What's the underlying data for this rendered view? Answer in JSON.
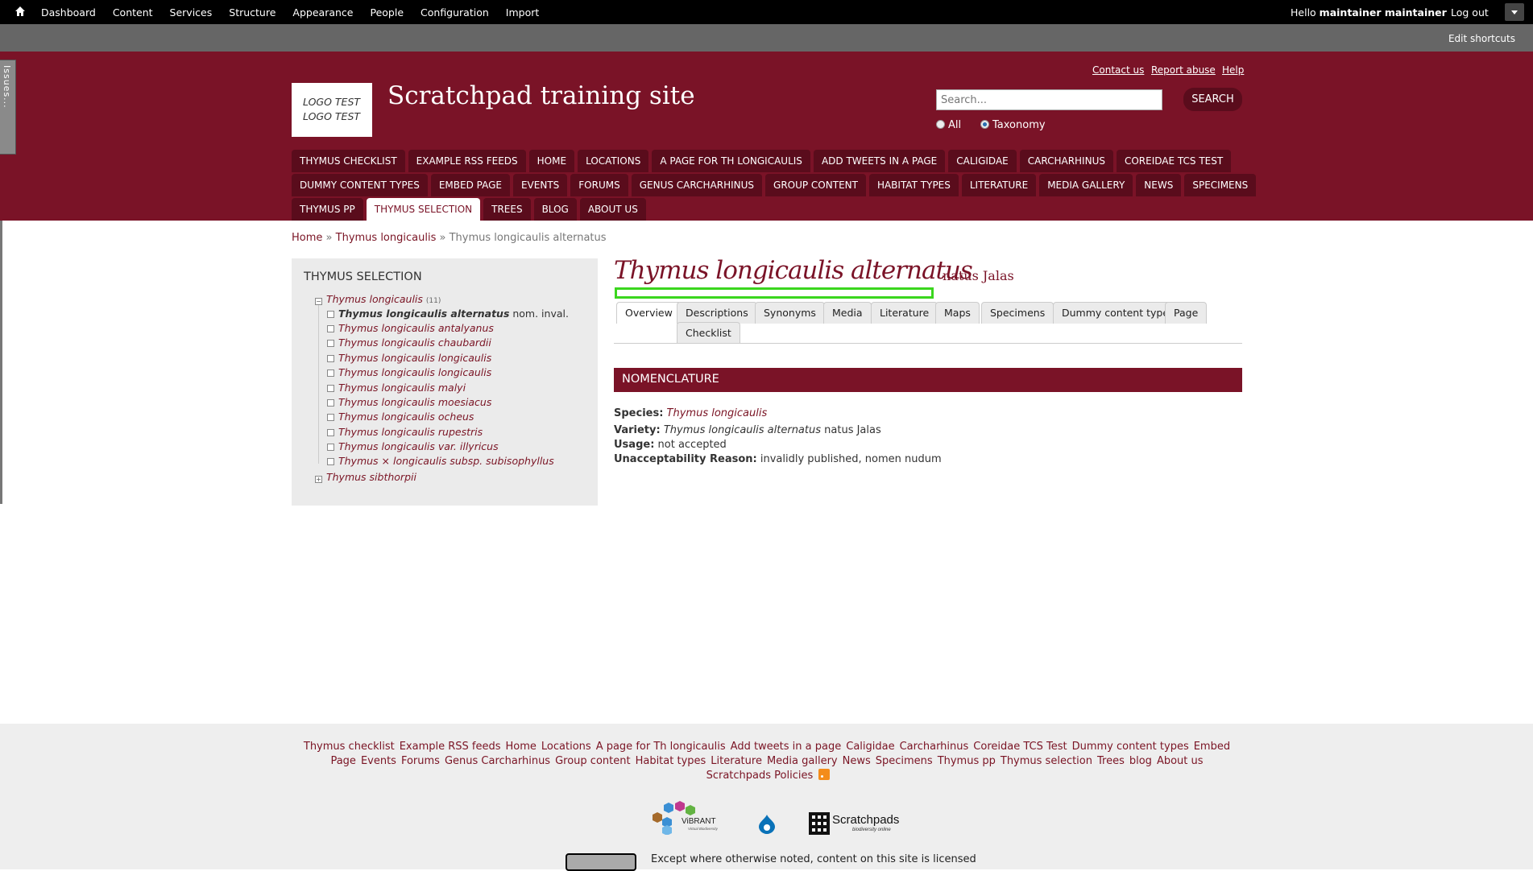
{
  "admin": {
    "menu": [
      "Dashboard",
      "Content",
      "Services",
      "Structure",
      "Appearance",
      "People",
      "Configuration",
      "Import"
    ],
    "hello_prefix": "Hello ",
    "user": "maintainer maintainer",
    "logout": "Log out"
  },
  "shortcuts": {
    "edit": "Edit shortcuts"
  },
  "issues_tab": "Issues...",
  "header": {
    "links": [
      "Contact us",
      "Report abuse",
      "Help"
    ],
    "logo_line1": "LOGO TEST",
    "logo_line2": "LOGO TEST",
    "site_name": "Scratchpad training site",
    "search_placeholder": "Search...",
    "search_button": "SEARCH",
    "radio_all": "All",
    "radio_taxonomy": "Taxonomy"
  },
  "nav": [
    [
      "Thymus checklist",
      "Example RSS feeds",
      "Home",
      "Locations",
      "A page for Th longicaulis",
      "Add tweets in a page",
      "Caligidae",
      "Carcharhinus",
      "Coreidae TCS Test"
    ],
    [
      "Dummy content types",
      "Embed page",
      "Events",
      "Forums",
      "Genus Carcharhinus",
      "Group content",
      "Habitat types",
      "Literature",
      "Media gallery",
      "News",
      "Specimens"
    ],
    [
      "Thymus pp",
      "Thymus selection",
      "Trees",
      "Blog",
      "About us"
    ]
  ],
  "breadcrumb": {
    "home": "Home",
    "parent": "Thymus longicaulis",
    "sep": "»",
    "current": "Thymus longicaulis alternatus"
  },
  "sidebar": {
    "title": "Thymus selection",
    "root": "Thymus longicaulis",
    "root_count": "(11)",
    "current": "Thymus longicaulis alternatus",
    "current_suffix": " nom. inval.",
    "children": [
      "Thymus longicaulis antalyanus",
      "Thymus longicaulis chaubardii",
      "Thymus longicaulis longicaulis",
      "Thymus longicaulis longicaulis",
      "Thymus longicaulis malyi",
      "Thymus longicaulis moesiacus",
      "Thymus longicaulis ocheus",
      "Thymus longicaulis rupestris",
      "Thymus longicaulis var. illyricus",
      "Thymus × longicaulis subsp. subisophyllus"
    ],
    "sibling": "Thymus sibthorpii"
  },
  "page": {
    "title": "Thymus longicaulis alternatus",
    "author": "natus Jalas",
    "tabs": [
      "Overview",
      "Descriptions",
      "Synonyms",
      "Media",
      "Literature",
      "Maps",
      "Specimens",
      "Dummy content type",
      "Page",
      "Checklist"
    ],
    "section": "Nomenclature",
    "species_label": "Species:",
    "species_value": "Thymus longicaulis",
    "variety_label": "Variety:",
    "variety_name": "Thymus longicaulis alternatus",
    "variety_author": " natus Jalas",
    "usage_label": "Usage:",
    "usage_value": " not accepted",
    "reason_label": "Unacceptability Reason:",
    "reason_value": " invalidly published, nomen nudum"
  },
  "footer": {
    "line1": [
      "Thymus checklist",
      "Example RSS feeds",
      "Home",
      "Locations",
      "A page for Th longicaulis",
      "Add tweets in a page",
      "Caligidae",
      "Carcharhinus",
      "Coreidae TCS Test",
      "Dummy content types",
      "Embed"
    ],
    "line2": [
      "Page",
      "Events",
      "Forums",
      "Genus Carcharhinus",
      "Group content",
      "Habitat types",
      "Literature",
      "Media gallery",
      "News",
      "Specimens",
      "Thymus pp",
      "Thymus selection",
      "Trees",
      "blog",
      "About us"
    ],
    "policies": "Scratchpads Policies",
    "vibrant": "ViBRANT",
    "vibrant_sub": "Virtual Biodiversity",
    "scratchpads": "Scratchpads",
    "scratchpads_sub": "biodiversity online",
    "license": "Except where otherwise noted, content on this site is licensed"
  },
  "colors": {
    "brand": "#7a1327",
    "highlight": "#3bd61e"
  }
}
